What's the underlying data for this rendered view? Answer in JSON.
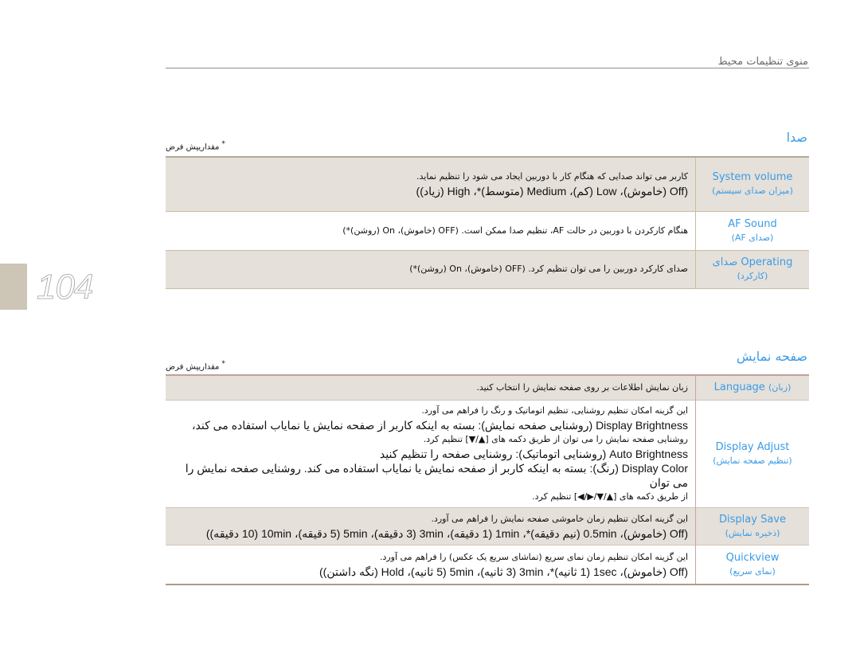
{
  "header": {
    "title": "منوی تنظیمات محیط"
  },
  "page": {
    "number": "104"
  },
  "sections": [
    {
      "title": "صدا",
      "default_note": "مقداریپش فرض",
      "default_note_star": "*",
      "rows": [
        {
          "label": "System volume",
          "label_sub": "(میزان صدای سیستم)",
          "lines": [
            "کاربر می تواند صدایی که هنگام کار با دوربین ایجاد می شود را تنظیم نماید.",
            "(Off (خاموش)، Low (کم)، Medium (متوسط)*، High (زیاد))"
          ],
          "shaded": true
        },
        {
          "label": "AF Sound",
          "label_sub": "(صدای AF)",
          "lines": [
            "هنگام کارکردن با دوربین در حالت AF، تنظیم صدا ممکن است. (OFF (خاموش)، On (روشن)*)"
          ],
          "shaded": false
        },
        {
          "label": "صدای Operating",
          "label_sub": "(کارکرد)",
          "lines": [
            "صدای کارکرد دوربین را می توان تنظیم کرد. (OFF (خاموش)، On (روشن)*)"
          ],
          "shaded": true
        }
      ]
    },
    {
      "title": "صفحه نمایش",
      "default_note": "مقداریپش فرض",
      "default_note_star": "*",
      "rows": [
        {
          "label": "Language",
          "label_sub": "(زبان)",
          "lines": [
            "زبان نمایش اطلاعات بر روی صفحه نمایش را انتخاب کنید."
          ],
          "shaded": true
        },
        {
          "label": "Display Adjust",
          "label_sub": "(تنظیم صفحه نمایش)",
          "lines": [
            "این گزینه امکان تنظیم روشنایی، تنظیم اتوماتیک و رنگ را فراهم می آورد.",
            "Display Brightness (روشنایی صفحه نمایش): بسته به اینکه کاربر از صفحه نمایش یا نمایاب استفاده می کند،",
            "روشنایی صفحه نمایش را می توان از طریق دکمه های [▲/▼] تنظیم کرد.",
            "Auto Brightness (روشنایی اتوماتیک): روشنایی صفحه را تنظیم کنید",
            "Display Color (رنگ): بسته به اینکه کاربر از صفحه نمایش یا نمایاب استفاده می کند. روشنایی صفحه نمایش را می توان",
            "از طریق دکمه های [▲/▼/▶/◀] تنظیم کرد."
          ],
          "shaded": false
        },
        {
          "label": "Display Save",
          "label_sub": "(ذخیره نمایش)",
          "lines": [
            "این گزینه امکان تنظیم زمان خاموشی صفحه نمایش را فراهم می آورد.",
            "(Off (خاموش)، 0.5min (نیم دقیقه)*، 1min (1 دقیقه)، 3min (3 دقیقه)، 5min (5 دقیقه)، 10min (10 دقیقه))"
          ],
          "shaded": true
        },
        {
          "label": "Quickview",
          "label_sub": "(نمای سریع)",
          "lines": [
            "این گزینه امکان تنظیم زمان نمای سریع (تماشای سریع یک عکس) را فراهم می آورد.",
            "(Off (خاموش)، 1sec (1 ثانیه)*، 3min (3 ثانیه)، 5min (5 ثانیه)، Hold (نگه داشتن))"
          ],
          "shaded": false
        }
      ]
    }
  ],
  "colors": {
    "accent": "#3a9be6",
    "row_shade": "#e5e0da",
    "side_tab": "#cdc5b5"
  }
}
